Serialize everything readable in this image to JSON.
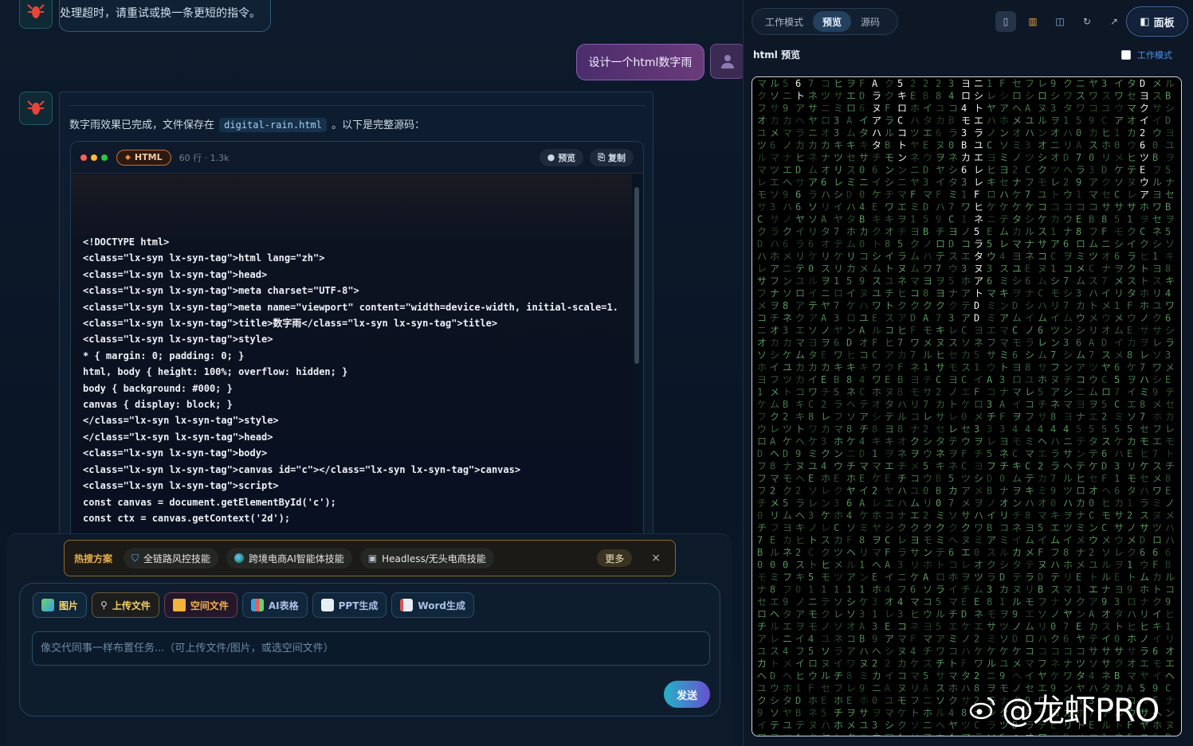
{
  "chat": {
    "ai_timeout_text": "处理超时，请重试或换一条更短的指令。",
    "user_prompt": "设计一个html数字雨",
    "reply_text_prefix": "数字雨效果已完成，文件保存在",
    "reply_file": "digital-rain.html",
    "reply_text_suffix": "。以下是完整源码：",
    "code_block": {
      "lang": "HTML",
      "meta": "60 行 · 1.3k",
      "preview_label": "预览",
      "copy_label": "复制",
      "lines": [
        "<!DOCTYPE html>",
        "<class=\"lx-syn lx-syn-tag\">html lang=\"zh\">",
        "<class=\"lx-syn lx-syn-tag\">head>",
        "<class=\"lx-syn lx-syn-tag\">meta charset=\"UTF-8\">",
        "<class=\"lx-syn lx-syn-tag\">meta name=\"viewport\" content=\"width=device-width, initial-scale=1.",
        "<class=\"lx-syn lx-syn-tag\">title>数字雨</class=\"lx-syn lx-syn-tag\">title>",
        "<class=\"lx-syn lx-syn-tag\">style>",
        "* { margin: 0; padding: 0; }",
        "html, body { height: 100%; overflow: hidden; }",
        "body { background: #000; }",
        "canvas { display: block; }",
        "</class=\"lx-syn lx-syn-tag\">style>",
        "</class=\"lx-syn lx-syn-tag\">head>",
        "<class=\"lx-syn lx-syn-tag\">body>",
        "<class=\"lx-syn lx-syn-tag\">canvas id=\"c\"></class=\"lx-syn lx-syn-tag\">canvas>",
        "<class=\"lx-syn lx-syn-tag\">script>",
        "const canvas = document.getElementById('c');",
        "const ctx = canvas.getContext('2d');"
      ]
    }
  },
  "hot": {
    "title": "热搜方案",
    "items": [
      "全链路风控技能",
      "跨境电商AI智能体技能",
      "Headless/无头电商技能"
    ],
    "more": "更多",
    "close": "×"
  },
  "composer": {
    "tools": [
      "图片",
      "上传文件",
      "空间文件",
      "AI表格",
      "PPT生成",
      "Word生成"
    ],
    "placeholder": "像交代同事一样布置任务...（可上传文件/图片，或选空间文件）",
    "send": "发送"
  },
  "panel": {
    "tabs": [
      "工作模式",
      "预览",
      "源码"
    ],
    "active_tab": "预览",
    "panel_button": "面板",
    "title": "html 预览",
    "work_mode_toggle": "工作模式",
    "work_mode_checked": false
  },
  "preview": {
    "background": "#000000",
    "rain_color": "#7fe08a",
    "rain_bright_color": "#e8f5e6",
    "glyph_columns": [
      "6ト",
      "Aラヌアハタ",
      "5キロCコトン",
      "ヨロ4モ3Bカ6",
      "ニシトエラユエレレFヒネ5ラタヌアトDD",
      "Dヨクイ26ツEウア"
    ]
  },
  "watermark": "@龙虾PRO",
  "colors": {
    "accent": "#23b3c8",
    "user_bubble": "#5a3473",
    "hot_border": "#8a6a2b"
  }
}
